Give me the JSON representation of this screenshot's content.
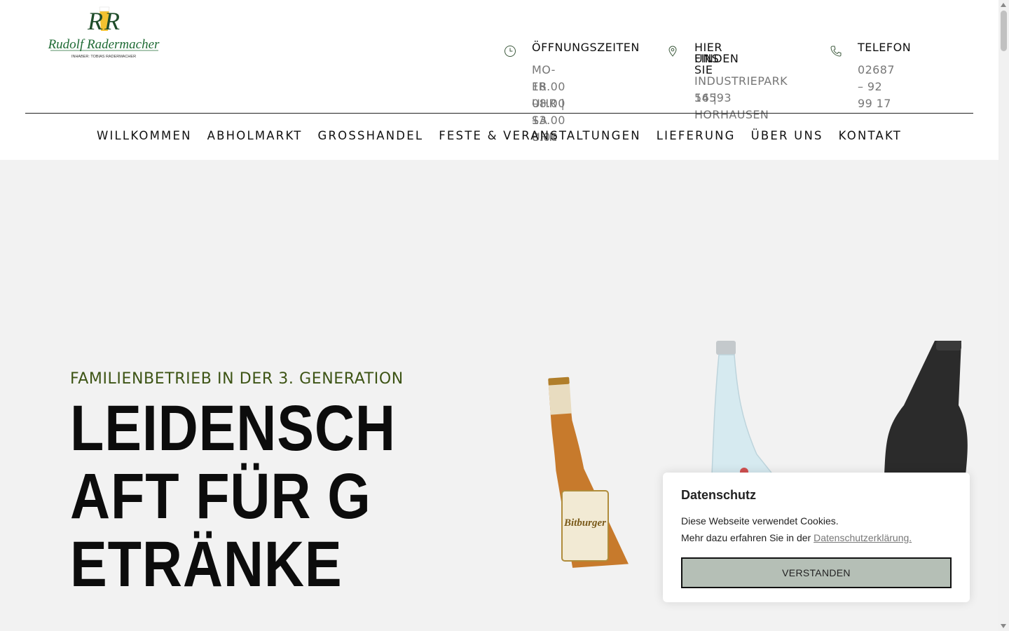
{
  "header": {
    "logo": {
      "monogram": "RR",
      "name": "Rudolf Radermacher",
      "subline": "INHABER: TOBIAS RADERMACHER"
    },
    "info": [
      {
        "icon": "clock-icon",
        "title": "ÖFFNUNGSZEITEN",
        "lines": [
          "MO-FR 08.00 –",
          "18.00 UHR | SA 8.00",
          "– 13.00 UHR"
        ]
      },
      {
        "icon": "map-pin-icon",
        "title_lines": [
          "HIER FINDEN SIE",
          "UNS"
        ],
        "lines": [
          "INDUSTRIEPARK 14 |",
          "56593 HORHAUSEN"
        ]
      },
      {
        "icon": "phone-icon",
        "title": "TELEFON",
        "lines": [
          "02687 – 92 99 17"
        ]
      }
    ]
  },
  "nav": {
    "items": [
      "WILLKOMMEN",
      "ABHOLMARKT",
      "GROSSHANDEL",
      "FESTE & VERANSTALTUNGEN",
      "LIEFERUNG",
      "ÜBER UNS",
      "KONTAKT"
    ]
  },
  "hero": {
    "kicker": "FAMILIENBETRIEB IN DER 3. GENERATION",
    "headline": "LEIDENSCHAFT FÜR GETRÄNKE",
    "beer_label": "Bitburger"
  },
  "cookie": {
    "title": "Datenschutz",
    "line1": "Diese Webseite verwendet Cookies.",
    "line2_prefix": "Mehr dazu erfahren Sie in der",
    "link": "Datenschutzerklärung.",
    "button": "VERSTANDEN"
  },
  "colors": {
    "accent_green": "#3d5415",
    "logo_green": "#1f6b35",
    "hero_bg": "#f2f2f2",
    "cookie_button": "#b5bfb6"
  }
}
